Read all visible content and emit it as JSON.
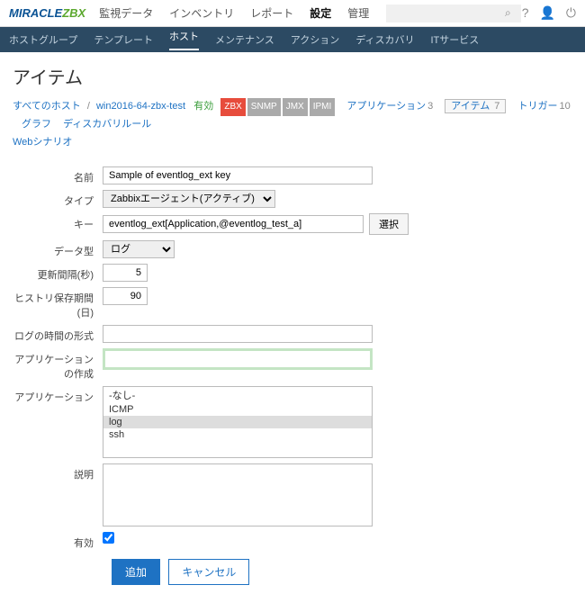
{
  "logo": {
    "part1": "MIRACLE",
    "part2": "ZBX"
  },
  "topmenu": [
    "監視データ",
    "インベントリ",
    "レポート",
    "設定",
    "管理"
  ],
  "topmenu_active": 3,
  "subnav": [
    "ホストグループ",
    "テンプレート",
    "ホスト",
    "メンテナンス",
    "アクション",
    "ディスカバリ",
    "ITサービス"
  ],
  "subnav_active": 2,
  "page_title": "アイテム",
  "crumbs": {
    "all_hosts": "すべてのホスト",
    "host": "win2016-64-zbx-test",
    "status": "有効",
    "badges": [
      "ZBX",
      "SNMP",
      "JMX",
      "IPMI"
    ],
    "tabs": [
      {
        "label": "アプリケーション",
        "count": "3"
      },
      {
        "label": "アイテム",
        "count": "7",
        "current": true
      },
      {
        "label": "トリガー",
        "count": "10"
      },
      {
        "label": "グラフ",
        "count": ""
      },
      {
        "label": "ディスカバリルール",
        "count": ""
      }
    ],
    "extra": "Webシナリオ"
  },
  "form": {
    "name_label": "名前",
    "name_value": "Sample of eventlog_ext key",
    "type_label": "タイプ",
    "type_value": "Zabbixエージェント(アクティブ)",
    "key_label": "キー",
    "key_value": "eventlog_ext[Application,@eventlog_test_a]",
    "key_btn": "選択",
    "datatype_label": "データ型",
    "datatype_value": "ログ",
    "interval_label": "更新間隔(秒)",
    "interval_value": "5",
    "history_label": "ヒストリ保存期間(日)",
    "history_value": "90",
    "logtime_label": "ログの時間の形式",
    "logtime_value": "",
    "newapp_label": "アプリケーションの作成",
    "newapp_value": "",
    "apps_label": "アプリケーション",
    "apps_options": [
      "-なし-",
      "ICMP",
      "log",
      "ssh"
    ],
    "apps_selected": 2,
    "desc_label": "説明",
    "desc_value": "",
    "enabled_label": "有効",
    "add_btn": "追加",
    "cancel_btn": "キャンセル"
  }
}
